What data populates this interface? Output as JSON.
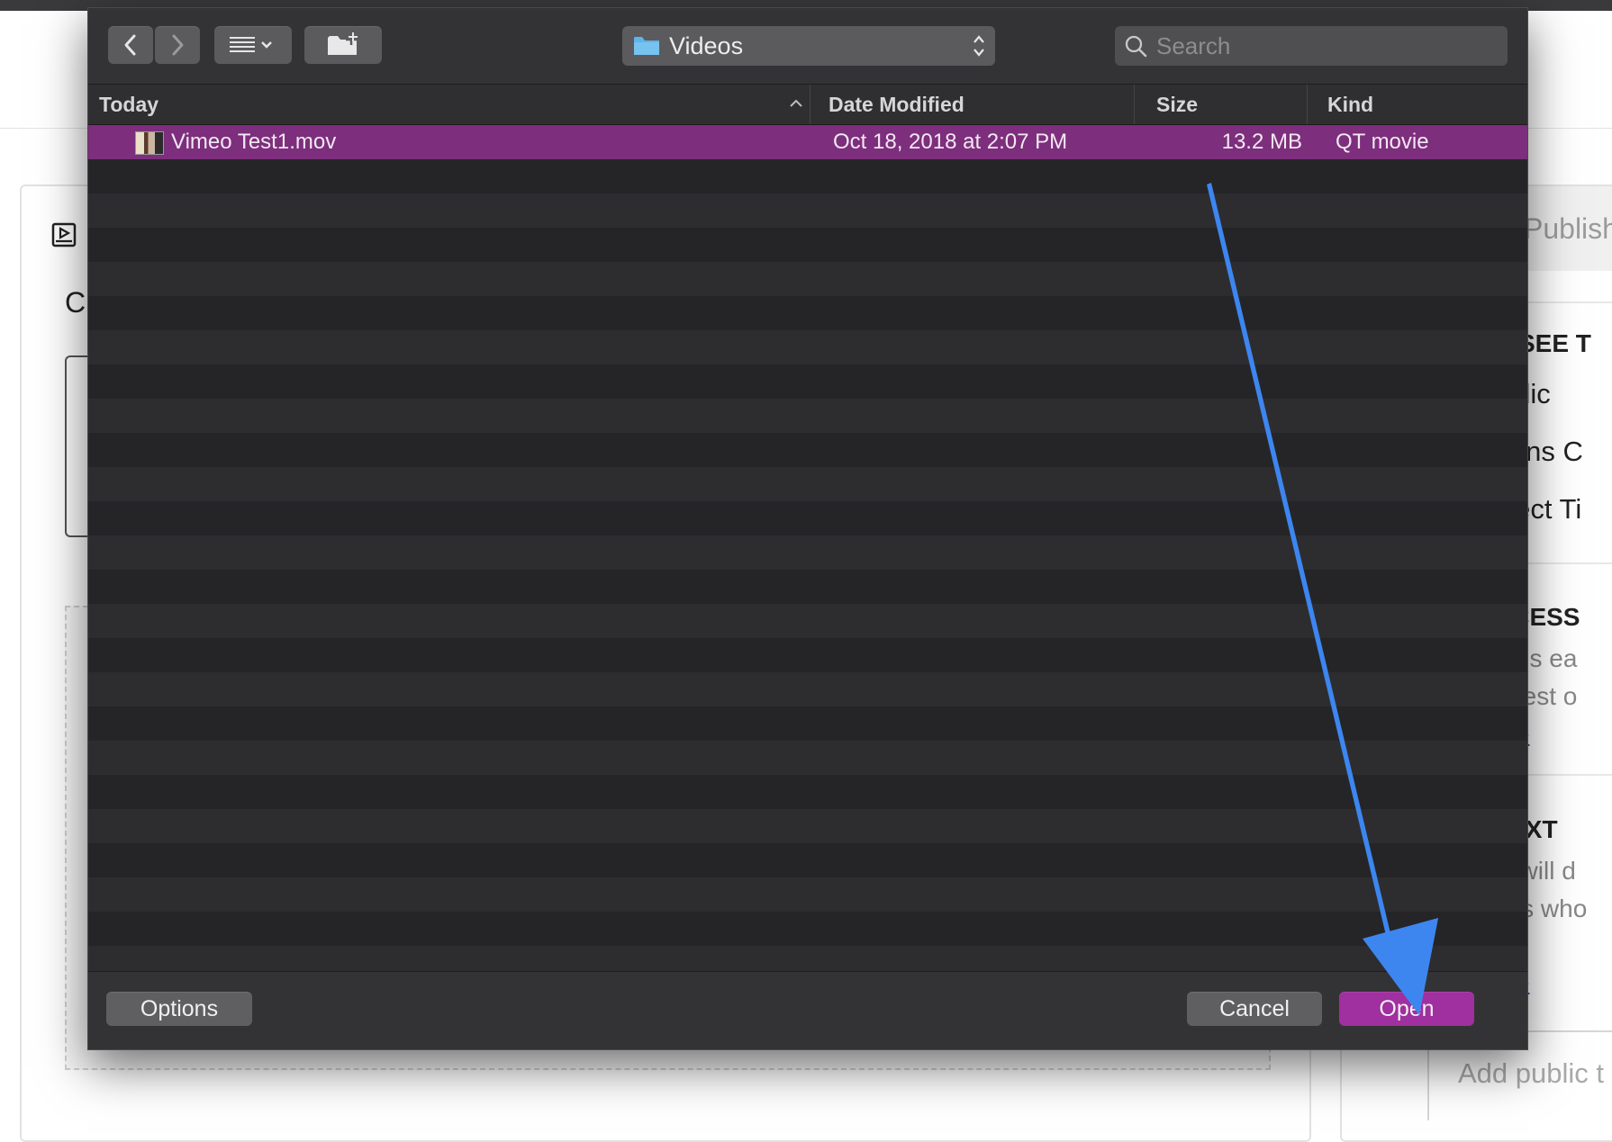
{
  "background_page": {
    "title_fragment": "C",
    "publish_label": "Publish",
    "right_panel": {
      "who_can_see_heading": "N SEE T",
      "options": [
        "ublic",
        "trons C",
        "elect Ti"
      ],
      "access_heading": "CCESS",
      "access_text_lines": [
        "rons ea",
        "e rest o"
      ],
      "access_link": "ore",
      "text_heading": "TEXT",
      "text_lines": [
        "xt will d",
        "ons who",
        "."
      ],
      "text_link": "ore",
      "add_public_placeholder": "Add public t"
    }
  },
  "dialog": {
    "toolbar": {
      "back_icon": "chevron-left-icon",
      "forward_icon": "chevron-right-icon",
      "view_icon": "list-view-icon",
      "new_folder_icon": "new-folder-icon",
      "location": "Videos",
      "search_placeholder": "Search",
      "search_value": ""
    },
    "columns": {
      "name": "Today",
      "date_modified": "Date Modified",
      "size": "Size",
      "kind": "Kind"
    },
    "files": [
      {
        "name": "Vimeo Test1.mov",
        "date_modified": "Oct 18, 2018 at 2:07 PM",
        "size": "13.2 MB",
        "kind": "QT movie",
        "selected": true
      }
    ],
    "footer": {
      "options_label": "Options",
      "cancel_label": "Cancel",
      "open_label": "Open"
    }
  },
  "colors": {
    "selection": "#7d2e7c",
    "primary_button": "#a02fa0",
    "annotation_arrow": "#3d86f0",
    "folder": "#5fb4e8"
  }
}
